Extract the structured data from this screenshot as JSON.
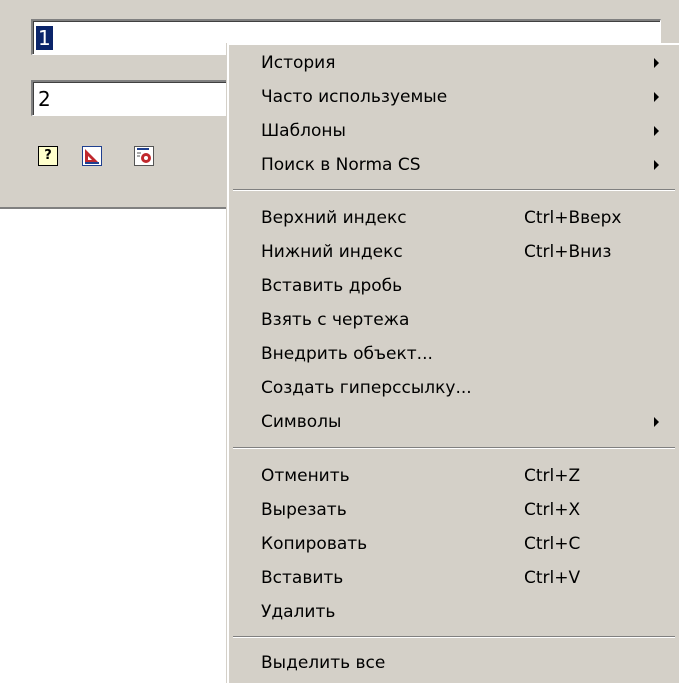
{
  "dialog": {
    "field1_value": "1",
    "field2_value": "2",
    "icons": [
      "help-icon",
      "ruler-triangle-icon",
      "document-settings-icon"
    ]
  },
  "menu": {
    "group1": [
      {
        "label": "История",
        "submenu": true
      },
      {
        "label": "Часто используемые",
        "submenu": true
      },
      {
        "label": "Шаблоны",
        "submenu": true
      },
      {
        "label": "Поиск в Norma CS",
        "submenu": true
      }
    ],
    "group2": [
      {
        "label": "Верхний индекс",
        "shortcut": "Ctrl+Вверх"
      },
      {
        "label": "Нижний индекс",
        "shortcut": "Ctrl+Вниз"
      },
      {
        "label": "Вставить дробь"
      },
      {
        "label": "Взять с чертежа"
      },
      {
        "label": "Внедрить объект..."
      },
      {
        "label": "Создать гиперссылку..."
      },
      {
        "label": "Символы",
        "submenu": true
      }
    ],
    "group3": [
      {
        "label": "Отменить",
        "shortcut": "Ctrl+Z"
      },
      {
        "label": "Вырезать",
        "shortcut": "Ctrl+X"
      },
      {
        "label": "Копировать",
        "shortcut": "Ctrl+C"
      },
      {
        "label": "Вставить",
        "shortcut": "Ctrl+V"
      },
      {
        "label": "Удалить"
      }
    ],
    "group4": [
      {
        "label": "Выделить все"
      }
    ]
  }
}
